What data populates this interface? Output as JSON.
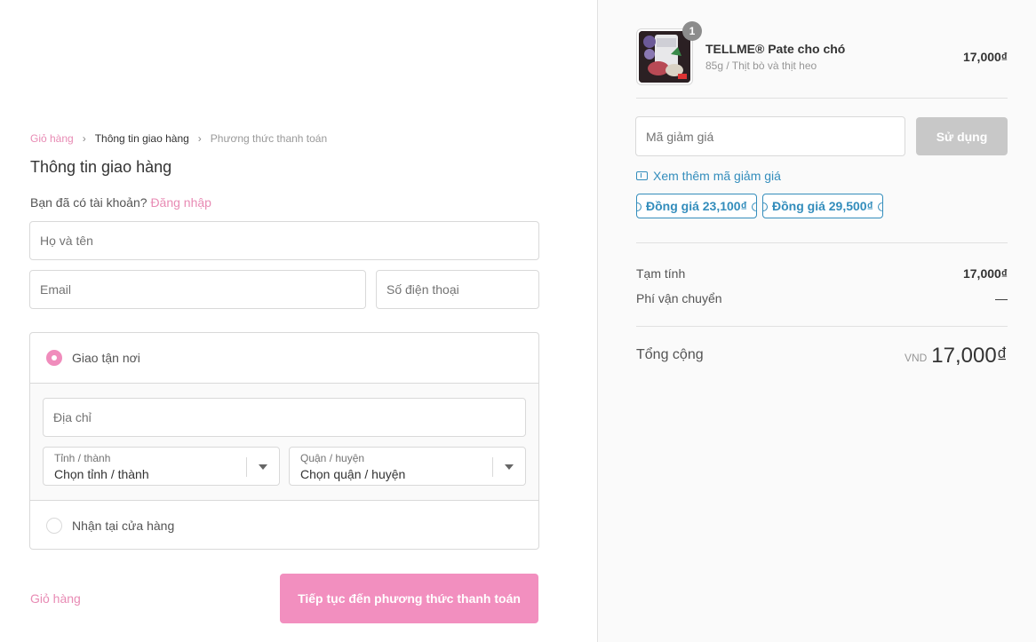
{
  "breadcrumb": {
    "cart": "Giỏ hàng",
    "shipping": "Thông tin giao hàng",
    "payment": "Phương thức thanh toán"
  },
  "form": {
    "title": "Thông tin giao hàng",
    "have_account": "Bạn đã có tài khoản?",
    "login": "Đăng nhập",
    "fullname_placeholder": "Họ và tên",
    "email_placeholder": "Email",
    "phone_placeholder": "Số điện thoại"
  },
  "shipping": {
    "deliver_label": "Giao tận nơi",
    "address_placeholder": "Địa chỉ",
    "province_label": "Tỉnh / thành",
    "province_value": "Chọn tỉnh / thành",
    "district_label": "Quận / huyện",
    "district_value": "Chọn quận / huyện",
    "pickup_label": "Nhận tại cửa hàng"
  },
  "footer": {
    "back": "Giỏ hàng",
    "continue": "Tiếp tục đến phương thức thanh toán"
  },
  "product": {
    "quantity": "1",
    "name": "TELLME® Pate cho chó",
    "variant": "85g / Thịt bò và thịt heo",
    "price": "17,000₫"
  },
  "discount": {
    "placeholder": "Mã giảm giá",
    "apply": "Sử dụng",
    "more": "Xem thêm mã giảm giá",
    "tags": [
      "Đồng giá 23,100₫",
      "Đồng giá 29,500₫"
    ]
  },
  "summary": {
    "subtotal_label": "Tạm tính",
    "subtotal_value": "17,000₫",
    "shipping_label": "Phí vận chuyển",
    "shipping_value": "—",
    "total_label": "Tổng cộng",
    "currency": "VND",
    "total_value": "17,000₫"
  },
  "colors": {
    "accent": "#e88bb4",
    "button": "#f28fbf",
    "link": "#338dbc"
  }
}
